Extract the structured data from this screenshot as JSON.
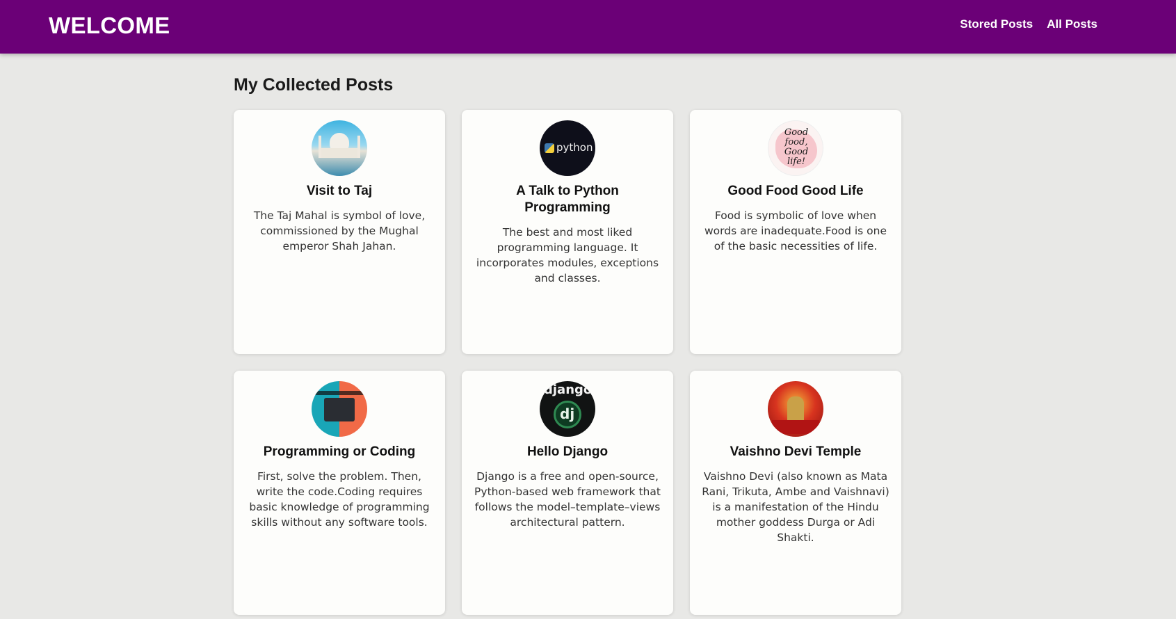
{
  "header": {
    "brand": "WELCOME",
    "nav": [
      {
        "label": "Stored Posts"
      },
      {
        "label": "All Posts"
      }
    ],
    "background_color": "#6b0077"
  },
  "main": {
    "section_title": "My Collected Posts",
    "posts": [
      {
        "title": "Visit to Taj",
        "text": "The Taj Mahal is symbol of love, commissioned by the Mughal emperor Shah Jahan.",
        "icon": "taj-mahal-image"
      },
      {
        "title": "A Talk to Python Programming",
        "text": "The best and most liked programming language. It incorporates modules, exceptions and classes.",
        "icon": "python-logo-image",
        "image_text": "python"
      },
      {
        "title": "Good Food Good Life",
        "text": "Food is symbolic of love when words are inadequate.Food is one of the basic necessities of life.",
        "icon": "good-food-image",
        "image_text": "Good food, Good life!"
      },
      {
        "title": "Programming or Coding",
        "text": "First, solve the problem. Then, write the code.Coding requires basic knowledge of programming skills without any software tools.",
        "icon": "coding-image"
      },
      {
        "title": "Hello Django",
        "text": "Django is a free and open-source, Python-based web framework that follows the model–template–views architectural pattern.",
        "icon": "django-logo-image",
        "image_text": "django",
        "image_badge": "dj"
      },
      {
        "title": "Vaishno Devi Temple",
        "text": "Vaishno Devi (also known as Mata Rani, Trikuta, Ambe and Vaishnavi) is a manifestation of the Hindu mother goddess Durga or Adi Shakti.",
        "icon": "temple-image"
      }
    ]
  }
}
